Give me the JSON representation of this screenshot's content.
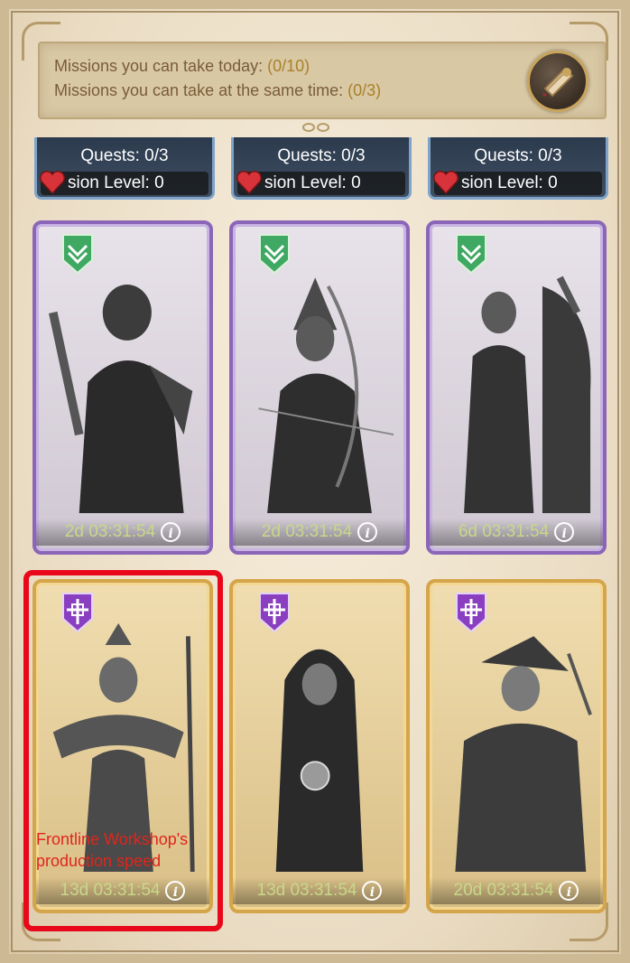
{
  "missions": {
    "today_label": "Missions you can take today: ",
    "today_value": "(0/10)",
    "same_time_label": "Missions you can take at the same time: ",
    "same_time_value": "(0/3)"
  },
  "top_cards": [
    {
      "quests": "Quests: 0/3",
      "mission_level": "sion Level: 0"
    },
    {
      "quests": "Quests: 0/3",
      "mission_level": "sion Level: 0"
    },
    {
      "quests": "Quests: 0/3",
      "mission_level": "sion Level: 0"
    }
  ],
  "heroes": [
    {
      "timer": "2d 03:31:54",
      "rarity": "purple",
      "badge": "chevron-badge"
    },
    {
      "timer": "2d 03:31:54",
      "rarity": "purple",
      "badge": "chevron-badge"
    },
    {
      "timer": "6d 03:31:54",
      "rarity": "purple",
      "badge": "chevron-badge"
    },
    {
      "timer": "13d 03:31:54",
      "rarity": "gold",
      "badge": "cross-badge",
      "tooltip": "Frontline Workshop's production speed"
    },
    {
      "timer": "13d 03:31:54",
      "rarity": "gold",
      "badge": "cross-badge"
    },
    {
      "timer": "20d 03:31:54",
      "rarity": "gold",
      "badge": "cross-badge"
    }
  ],
  "colors": {
    "highlight": "#e8071b",
    "purple_frame": "#8b66b8",
    "gold_frame": "#d4a54a",
    "timer_text": "#c8d88a",
    "tooltip_text": "#e0251c"
  }
}
